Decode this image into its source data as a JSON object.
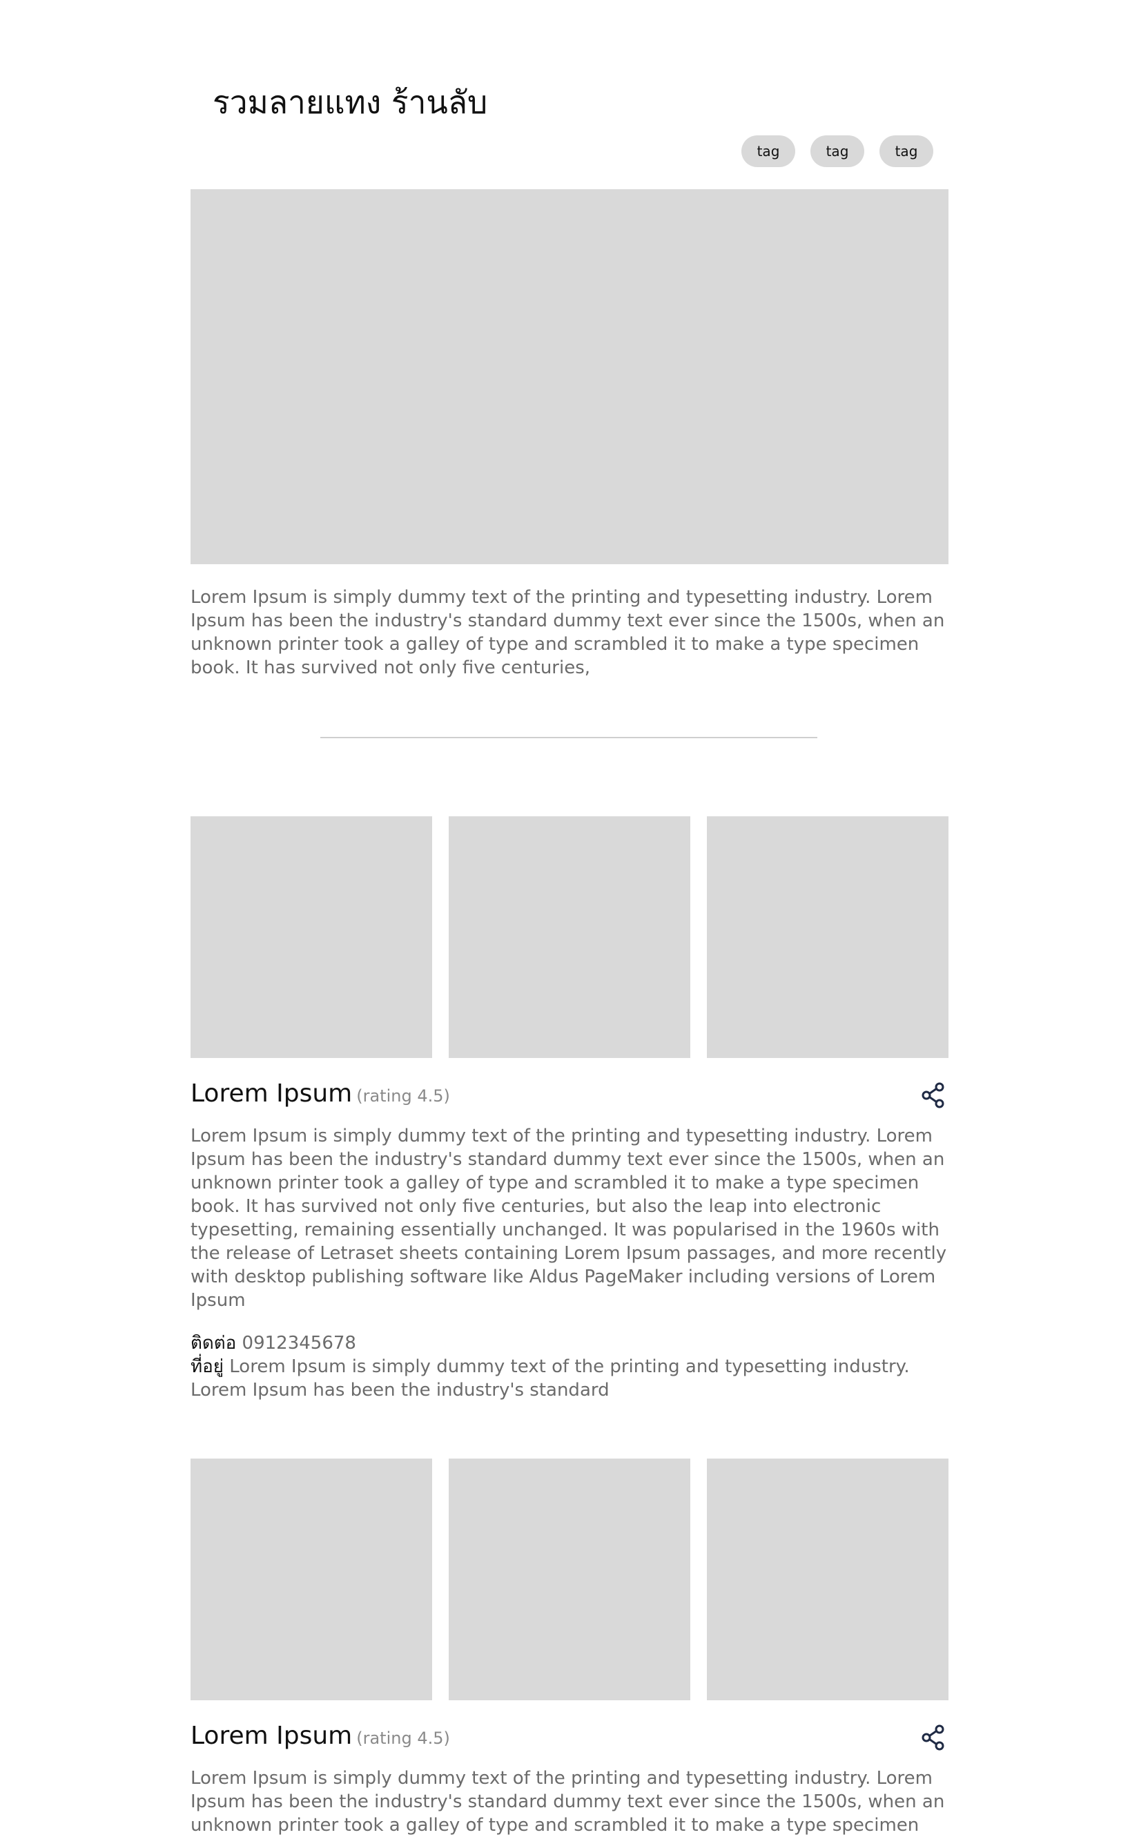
{
  "header": {
    "title": "รวมลายแทง ร้านลับ",
    "tags": [
      "tag",
      "tag",
      "tag"
    ]
  },
  "intro": {
    "text": "Lorem Ipsum is simply dummy text of the printing and typesetting industry. Lorem Ipsum has been the industry's standard dummy text ever since the 1500s, when an unknown printer took a galley of type and scrambled it to make a type specimen book. It has survived not only five centuries,"
  },
  "shops": [
    {
      "name": "Lorem Ipsum",
      "rating": "(rating 4.5)",
      "description": "Lorem Ipsum is simply dummy text of the printing and typesetting industry. Lorem Ipsum has been the industry's standard dummy text ever since the 1500s, when an unknown printer took a galley of type and scrambled it to make a type specimen book. It has survived not only five centuries, but also the leap into electronic typesetting, remaining essentially unchanged. It was popularised in the 1960s with the release of Letraset sheets containing Lorem Ipsum passages, and more recently with desktop publishing software like Aldus PageMaker including versions of Lorem Ipsum",
      "contact_label": "ติดต่อ",
      "contact_value": "0912345678",
      "address_label": "ที่อยู่",
      "address_value": "Lorem Ipsum is simply dummy text of the printing and typesetting industry. Lorem Ipsum has been the industry's standard"
    },
    {
      "name": "Lorem Ipsum",
      "rating": "(rating 4.5)",
      "description": "Lorem Ipsum is simply dummy text of the printing and typesetting industry. Lorem Ipsum has been the industry's standard dummy text ever since the 1500s, when an unknown printer took a galley of type and scrambled it to make a type specimen"
    }
  ],
  "icons": {
    "share": "share-icon"
  },
  "colors": {
    "placeholder": "#d9d9d9",
    "body_text": "#6b6b6b",
    "heading": "#111111",
    "share_icon": "#1f2a44"
  }
}
